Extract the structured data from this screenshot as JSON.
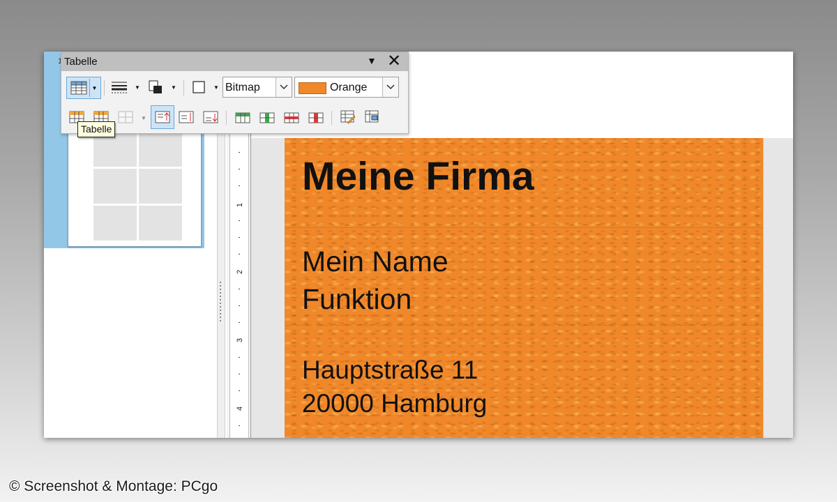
{
  "toolbar": {
    "title": "Tabelle",
    "area_style_value": "Bitmap",
    "area_fill_value": "Orange",
    "tooltip": "Tabelle"
  },
  "slides_panel": {
    "slide_number": "1"
  },
  "card": {
    "company": "Meine Firma",
    "name": "Mein Name",
    "function": "Funktion",
    "street": "Hauptstraße 11",
    "city": "20000 Hamburg",
    "fill_color": "#f0882a"
  },
  "ruler": {
    "numbers": [
      "1",
      "2",
      "3",
      "4"
    ]
  },
  "icons": [
    "table-icon",
    "dropdown-arrow-icon",
    "border-style-icon",
    "border-color-icon",
    "borders-icon",
    "insert-row-above-icon",
    "insert-row-below-icon",
    "merge-cells-icon",
    "align-top-icon",
    "align-center-icon",
    "align-bottom-icon",
    "insert-column-icon",
    "delete-row-icon",
    "delete-column-icon",
    "table-design-icon",
    "table-properties-icon"
  ],
  "watermark": "© Screenshot & Montage: PCgo"
}
